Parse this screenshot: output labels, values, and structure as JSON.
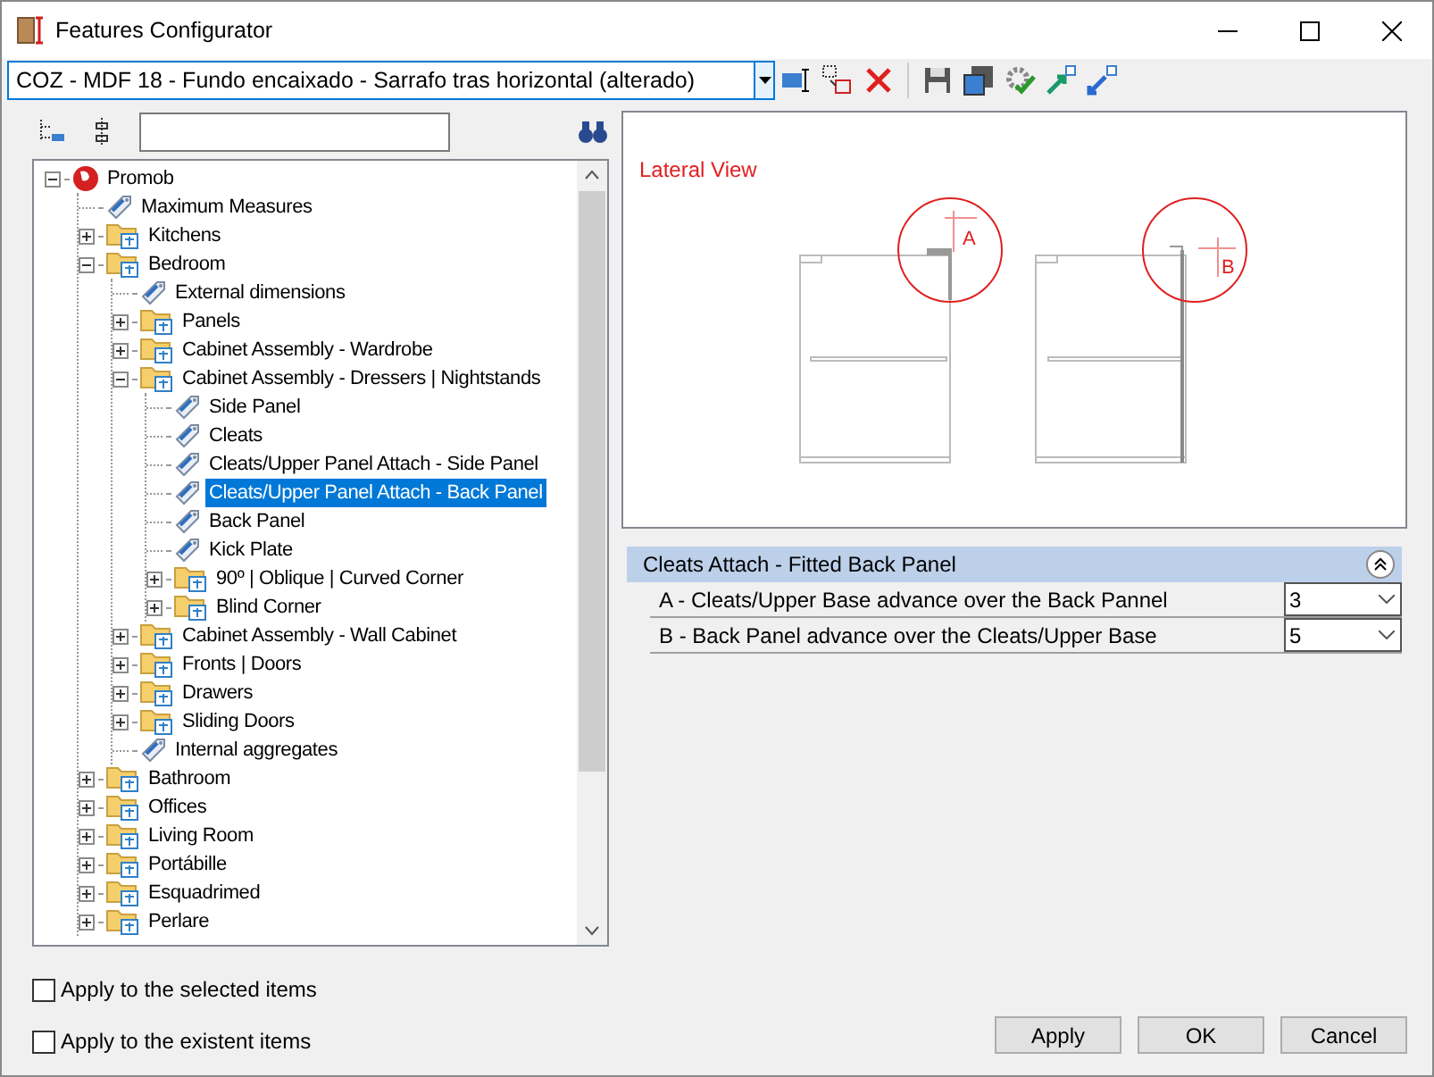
{
  "window": {
    "title": "Features Configurator"
  },
  "preset": {
    "value": "COZ - MDF 18 - Fundo encaixado - Sarrafo tras horizontal (alterado)"
  },
  "tree": [
    {
      "label": "Promob",
      "kind": "root",
      "expanded": true,
      "selected": false,
      "children": [
        {
          "label": "Maximum Measures",
          "kind": "item",
          "selected": false
        },
        {
          "label": "Kitchens",
          "kind": "folder",
          "expanded": false,
          "selected": false
        },
        {
          "label": "Bedroom",
          "kind": "folder",
          "expanded": true,
          "selected": false,
          "children": [
            {
              "label": "External dimensions",
              "kind": "item",
              "selected": false
            },
            {
              "label": "Panels",
              "kind": "folder",
              "expanded": false,
              "selected": false
            },
            {
              "label": "Cabinet Assembly - Wardrobe",
              "kind": "folder",
              "expanded": false,
              "selected": false
            },
            {
              "label": "Cabinet Assembly - Dressers | Nightstands",
              "kind": "folder",
              "expanded": true,
              "selected": false,
              "children": [
                {
                  "label": "Side Panel",
                  "kind": "item",
                  "selected": false
                },
                {
                  "label": "Cleats",
                  "kind": "item",
                  "selected": false
                },
                {
                  "label": "Cleats/Upper Panel Attach - Side Panel",
                  "kind": "item",
                  "selected": false
                },
                {
                  "label": "Cleats/Upper Panel Attach - Back Panel",
                  "kind": "item",
                  "selected": true
                },
                {
                  "label": "Back Panel",
                  "kind": "item",
                  "selected": false
                },
                {
                  "label": "Kick Plate",
                  "kind": "item",
                  "selected": false
                },
                {
                  "label": "90º | Oblique | Curved Corner",
                  "kind": "folder",
                  "expanded": false,
                  "selected": false
                },
                {
                  "label": "Blind Corner",
                  "kind": "folder",
                  "expanded": false,
                  "selected": false
                }
              ]
            },
            {
              "label": "Cabinet Assembly - Wall Cabinet",
              "kind": "folder",
              "expanded": false,
              "selected": false
            },
            {
              "label": "Fronts | Doors",
              "kind": "folder",
              "expanded": false,
              "selected": false
            },
            {
              "label": "Drawers",
              "kind": "folder",
              "expanded": false,
              "selected": false
            },
            {
              "label": "Sliding Doors",
              "kind": "folder",
              "expanded": false,
              "selected": false
            },
            {
              "label": "Internal aggregates",
              "kind": "item",
              "selected": false
            }
          ]
        },
        {
          "label": "Bathroom",
          "kind": "folder",
          "expanded": false,
          "selected": false
        },
        {
          "label": "Offices",
          "kind": "folder",
          "expanded": false,
          "selected": false
        },
        {
          "label": "Living Room",
          "kind": "folder",
          "expanded": false,
          "selected": false
        },
        {
          "label": "Portábille",
          "kind": "folder",
          "expanded": false,
          "selected": false
        },
        {
          "label": "Esquadrimed",
          "kind": "folder",
          "expanded": false,
          "selected": false
        },
        {
          "label": "Perlare",
          "kind": "folder",
          "expanded": false,
          "selected": false
        }
      ]
    }
  ],
  "preview": {
    "title": "Lateral View",
    "marker_a": "A",
    "marker_b": "B"
  },
  "properties": {
    "title": "Cleats Attach - Fitted Back Panel",
    "expanded": true,
    "rows": [
      {
        "label": "A - Cleats/Upper Base advance over the Back Pannel",
        "value": "3"
      },
      {
        "label": "B - Back Panel advance over the Cleats/Upper Base",
        "value": "5"
      }
    ]
  },
  "options": [
    {
      "label": "Apply to the selected items",
      "checked": false
    },
    {
      "label": "Apply to the existent items",
      "checked": false
    }
  ],
  "buttons": [
    "Apply",
    "OK",
    "Cancel"
  ]
}
